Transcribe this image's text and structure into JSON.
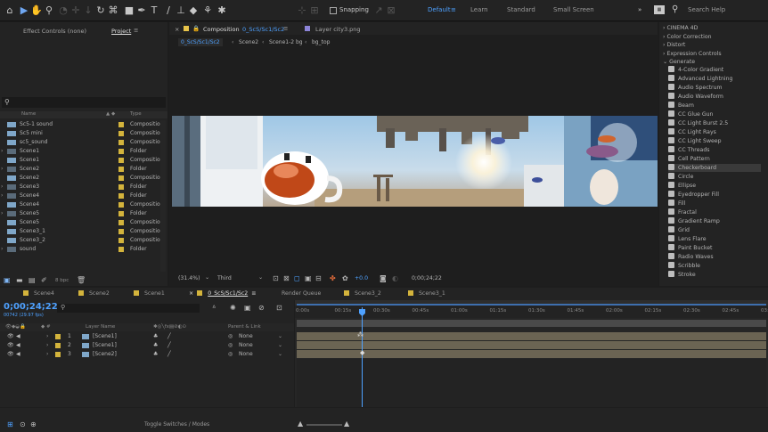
{
  "toolbar": {
    "snapping_label": "Snapping",
    "workspaces": [
      "Default",
      "Learn",
      "Standard",
      "Small Screen"
    ],
    "search_placeholder": "Search Help"
  },
  "project_panel": {
    "tabs": [
      "Effect Controls (none)",
      "Project"
    ],
    "search_icon": "magnifier",
    "columns": {
      "name": "Name",
      "type": "Type"
    },
    "items": [
      {
        "name": "Sc5-1 sound",
        "type": "Composition",
        "color": "#d4b43c",
        "kind": "comp"
      },
      {
        "name": "Sc5 mini",
        "type": "Composition",
        "color": "#d4b43c",
        "kind": "comp"
      },
      {
        "name": "sc5_sound",
        "type": "Composition",
        "color": "#d4b43c",
        "kind": "comp"
      },
      {
        "name": "Scene1",
        "type": "Folder",
        "color": "#d4b43c",
        "kind": "folder"
      },
      {
        "name": "Scene1",
        "type": "Composition",
        "color": "#d4b43c",
        "kind": "comp"
      },
      {
        "name": "Scene2",
        "type": "Folder",
        "color": "#d4b43c",
        "kind": "folder"
      },
      {
        "name": "Scene2",
        "type": "Composition",
        "color": "#d4b43c",
        "kind": "comp"
      },
      {
        "name": "Scene3",
        "type": "Folder",
        "color": "#d4b43c",
        "kind": "folder"
      },
      {
        "name": "Scene4",
        "type": "Folder",
        "color": "#d4b43c",
        "kind": "folder"
      },
      {
        "name": "Scene4",
        "type": "Composition",
        "color": "#d4b43c",
        "kind": "comp"
      },
      {
        "name": "Scene5",
        "type": "Folder",
        "color": "#d4b43c",
        "kind": "folder"
      },
      {
        "name": "Scene5",
        "type": "Composition",
        "color": "#d4b43c",
        "kind": "comp"
      },
      {
        "name": "Scene3_1",
        "type": "Composition",
        "color": "#d4b43c",
        "kind": "comp"
      },
      {
        "name": "Scene3_2",
        "type": "Composition",
        "color": "#d4b43c",
        "kind": "comp"
      },
      {
        "name": "sound",
        "type": "Folder",
        "color": "#d4b43c",
        "kind": "folder"
      }
    ],
    "footer_bpc": "8 bpc"
  },
  "composition": {
    "tab_label": "Composition",
    "comp_name": "0_ScS/Sc1/Sc2",
    "layer_tab": "Layer city3.png",
    "breadcrumbs": [
      "0_ScS/Sc1/Sc2",
      "Scene2",
      "Scene1-2 bg",
      "bg_top"
    ],
    "zoom": "(31.4%)",
    "resolution": "Third",
    "exposure": "+0.0",
    "timecode": "0;00;24;22"
  },
  "effects_panel": {
    "categories": [
      "CINEMA 4D",
      "Color Correction",
      "Distort",
      "Expression Controls",
      "Generate"
    ],
    "items": [
      "4-Color Gradient",
      "Advanced Lightning",
      "Audio Spectrum",
      "Audio Waveform",
      "Beam",
      "CC Glue Gun",
      "CC Light Burst 2.5",
      "CC Light Rays",
      "CC Light Sweep",
      "CC Threads",
      "Cell Pattern",
      "Checkerboard",
      "Circle",
      "Ellipse",
      "Eyedropper Fill",
      "Fill",
      "Fractal",
      "Gradient Ramp",
      "Grid",
      "Lens Flare",
      "Paint Bucket",
      "Radio Waves",
      "Scribble",
      "Stroke"
    ],
    "selected": "Checkerboard"
  },
  "timeline": {
    "tabs": [
      "Scene4",
      "Scene2",
      "Scene1",
      "0_ScS/Sc1/Sc2",
      "Render Queue",
      "Scene3_2",
      "Scene3_1"
    ],
    "active_tab": "0_ScS/Sc1/Sc2",
    "timecode": "0;00;24;22",
    "timecode_sub": "00742 (29.97 fps)",
    "search_placeholder": "",
    "columns": {
      "layer_name": "Layer Name",
      "parent": "Parent & Link"
    },
    "layers": [
      {
        "num": "1",
        "name": "[Scene1]",
        "parent": "None"
      },
      {
        "num": "2",
        "name": "[Scene1]",
        "parent": "None"
      },
      {
        "num": "3",
        "name": "[Scene2]",
        "parent": "None"
      }
    ],
    "ruler": [
      "0:00s",
      "00:15s",
      "00:30s",
      "00:45s",
      "01:00s",
      "01:15s",
      "01:30s",
      "01:45s",
      "02:00s",
      "02:15s",
      "02:30s",
      "02:45s",
      "03:0"
    ],
    "footer": "Toggle Switches / Modes",
    "accent": "#2d8ceb"
  }
}
